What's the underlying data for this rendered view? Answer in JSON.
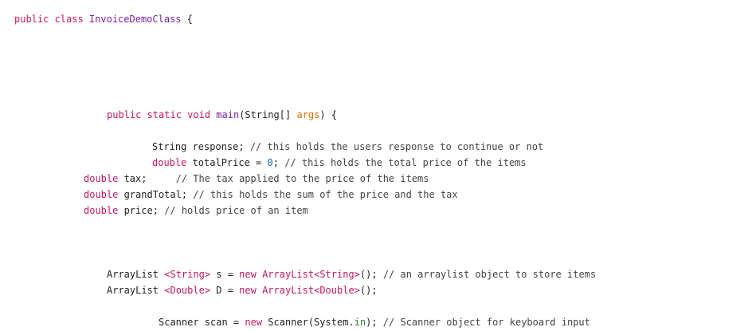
{
  "code": {
    "l1": {
      "kw": "public class ",
      "cls": "InvoiceDemoClass",
      "rest": " {"
    },
    "l2": {
      "kw": "public static void ",
      "cls": "main",
      "p1": "(String[] ",
      "args": "args",
      "p2": ") {"
    },
    "l3": {
      "t1": "String response; ",
      "c": "// this holds the users response to continue or not"
    },
    "l4": {
      "kw": "double ",
      "t1": "totalPrice = ",
      "num": "0",
      "t2": "; ",
      "c": "// this holds the total price of the items"
    },
    "l5": {
      "kw": "double ",
      "t1": "tax;     ",
      "c": "// The tax applied to the price of the items"
    },
    "l6": {
      "kw": "double ",
      "t1": "grandTotal; ",
      "c": "// this holds the sum of the price and the tax"
    },
    "l7": {
      "kw": "double ",
      "t1": "price; ",
      "c": "// holds price of an item"
    },
    "l8": {
      "t1": "ArrayList ",
      "g1": "<String>",
      "t2": " s = ",
      "kw": "new ",
      "cls": "ArrayList",
      "g2": "<String>",
      "t3": "(); ",
      "c": "// an arraylist object to store items"
    },
    "l9": {
      "t1": "ArrayList ",
      "g1": "<Double>",
      "t2": " D = ",
      "kw": "new ",
      "cls": "ArrayList",
      "g2": "<Double>",
      "t3": "();"
    },
    "l10": {
      "t1": "Scanner scan = ",
      "kw": "new ",
      "t2": "Scanner(System.",
      "f": "in",
      "t3": "); ",
      "c": "// Scanner object for keyboard input"
    }
  },
  "colors": {
    "keyword": "#c2185b",
    "class": "#7b1fa2",
    "param": "#e06c00",
    "number": "#1565c0",
    "text": "#222222"
  }
}
